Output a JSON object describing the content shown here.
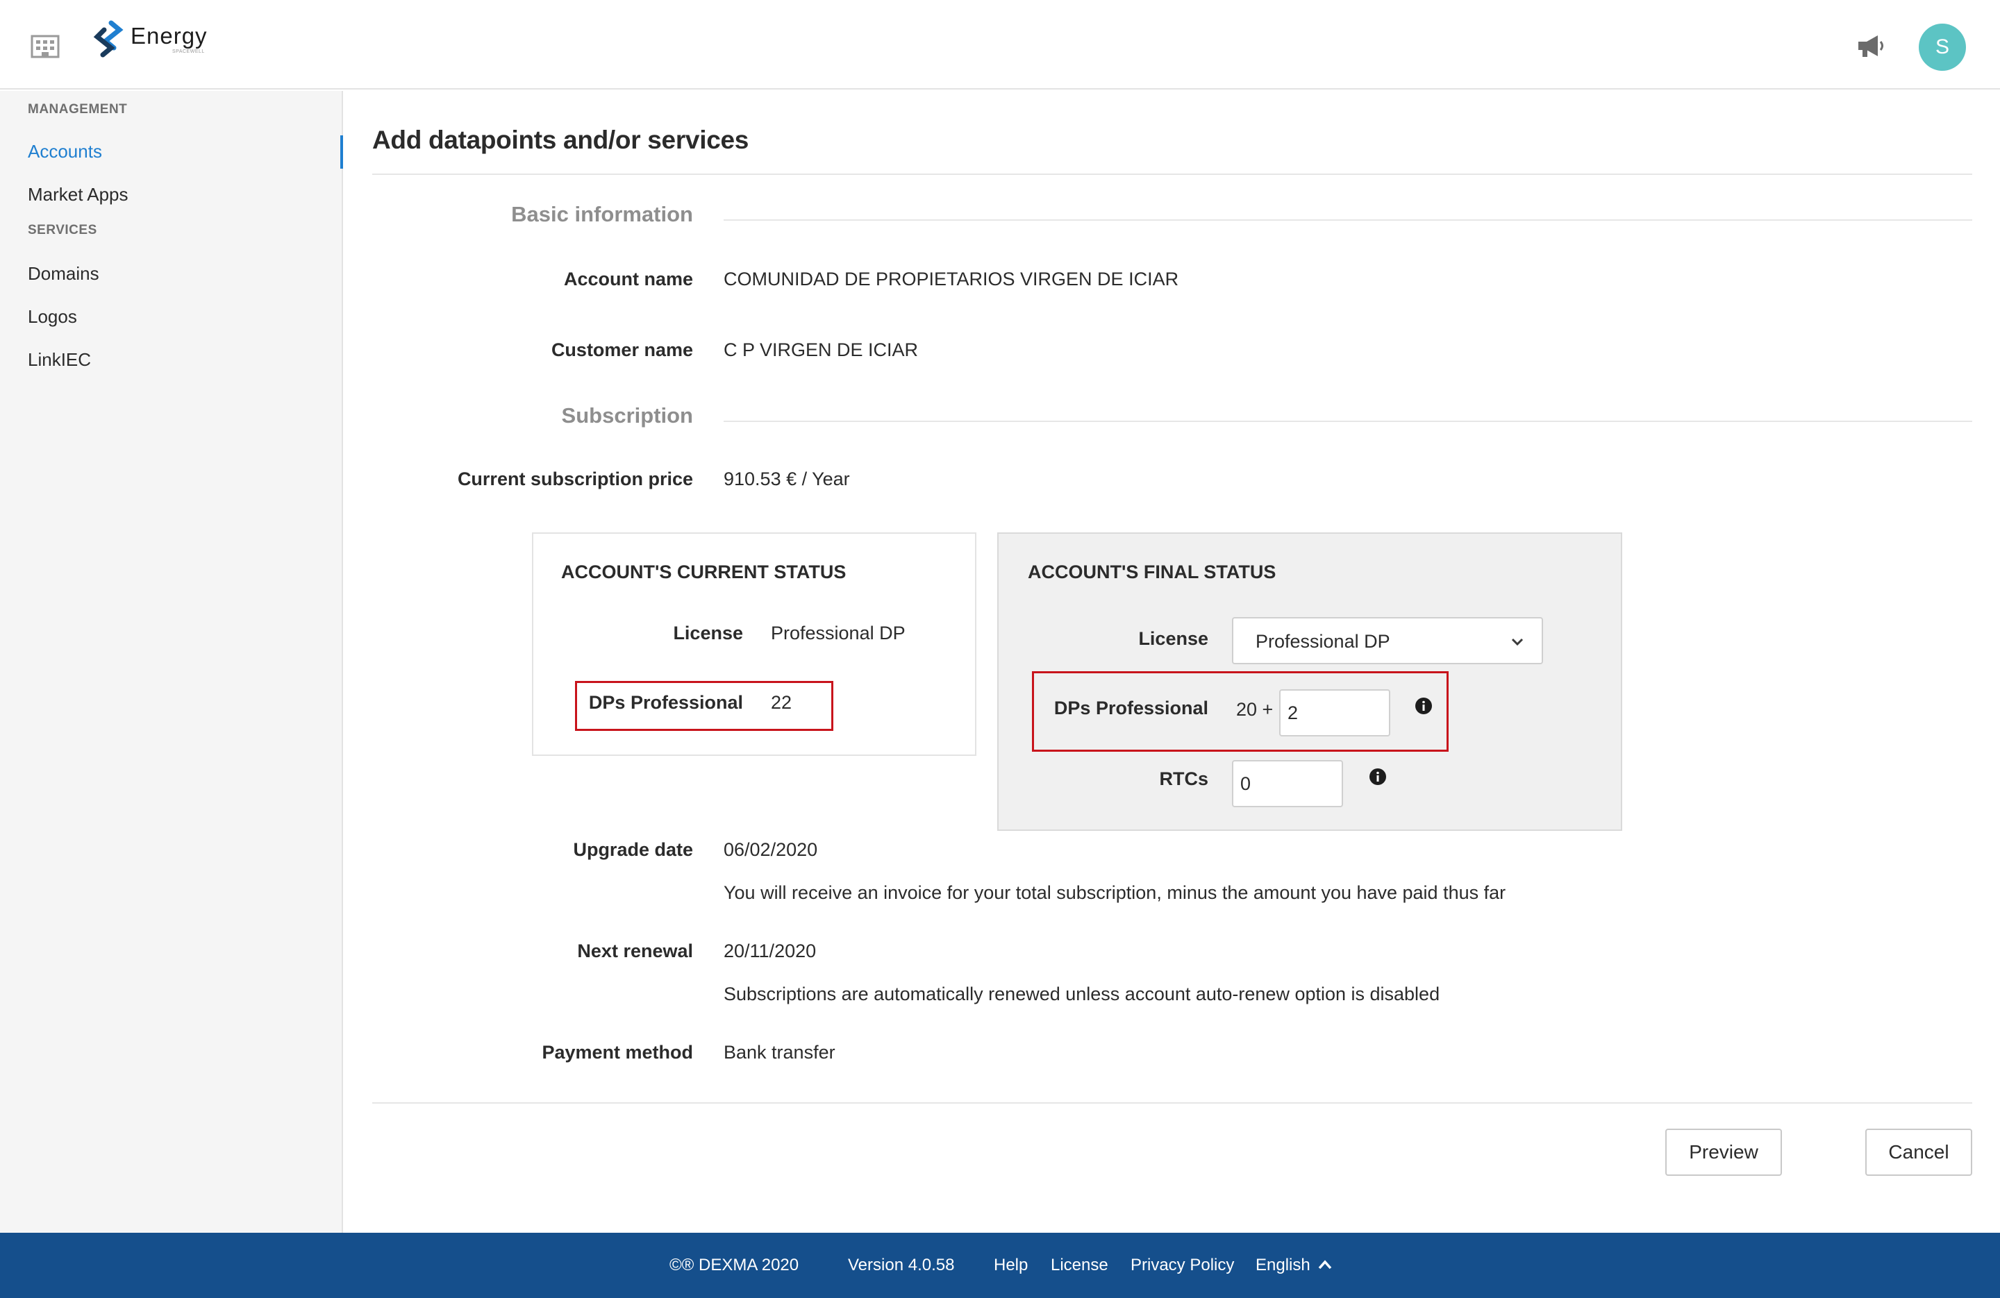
{
  "header": {
    "brand_name": "Energy",
    "brand_sub": "SPACEWELL",
    "avatar_initial": "S",
    "accent_color": "#5cc4c4"
  },
  "sidebar": {
    "management_title": "MANAGEMENT",
    "management_items": [
      {
        "label": "Accounts",
        "active": true
      },
      {
        "label": "Market Apps",
        "active": false
      }
    ],
    "services_title": "SERVICES",
    "services_items": [
      {
        "label": "Domains"
      },
      {
        "label": "Logos"
      },
      {
        "label": "LinkIEC"
      }
    ],
    "active_color": "#1f7fd0"
  },
  "page": {
    "title": "Add datapoints and/or services",
    "basic_info_title": "Basic information",
    "account_name_label": "Account name",
    "account_name": "COMUNIDAD DE PROPIETARIOS VIRGEN DE ICIAR",
    "customer_name_label": "Customer name",
    "customer_name": "C P VIRGEN DE ICIAR",
    "subscription_title": "Subscription",
    "price_label": "Current subscription price",
    "price_value": "910.53 € / Year",
    "current_status": {
      "title": "ACCOUNT'S CURRENT STATUS",
      "license_label": "License",
      "license_value": "Professional DP",
      "dps_label": "DPs Professional",
      "dps_value": "22"
    },
    "final_status": {
      "title": "ACCOUNT'S FINAL STATUS",
      "license_label": "License",
      "license_selected": "Professional DP",
      "dps_label": "DPs Professional",
      "dps_base": "20 +",
      "dps_input_value": "2",
      "rtcs_label": "RTCs",
      "rtcs_input_value": "0"
    },
    "upgrade_date_label": "Upgrade date",
    "upgrade_date": "06/02/2020",
    "upgrade_note": "You will receive an invoice for your total subscription, minus the amount you have paid thus far",
    "next_renewal_label": "Next renewal",
    "next_renewal": "20/11/2020",
    "renewal_note": "Subscriptions are automatically renewed unless account auto-renew option is disabled",
    "payment_method_label": "Payment method",
    "payment_method": "Bank transfer",
    "preview_button": "Preview",
    "cancel_button": "Cancel",
    "highlight_color": "#c8141c"
  },
  "footer": {
    "copyright": "©® DEXMA 2020",
    "version": "Version 4.0.58",
    "help": "Help",
    "license": "License",
    "privacy": "Privacy Policy",
    "language": "English",
    "background_color": "#154f8c"
  }
}
